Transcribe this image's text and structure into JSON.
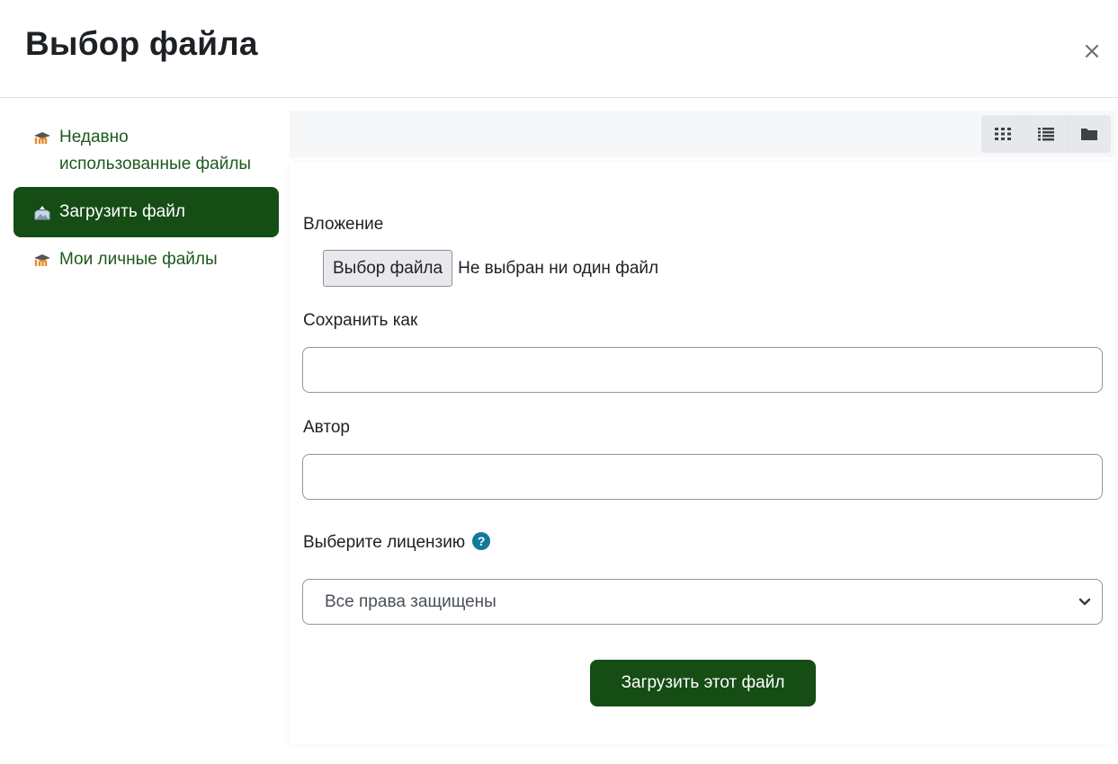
{
  "dialog": {
    "title": "Выбор файла",
    "close_symbol": "×"
  },
  "sidebar": {
    "items": [
      {
        "label": "Недавно использованные файлы",
        "icon": "moodle-logo-icon",
        "active": false
      },
      {
        "label": "Загрузить файл",
        "icon": "upload-icon",
        "active": true
      },
      {
        "label": "Мои личные файлы",
        "icon": "moodle-logo-icon",
        "active": false
      }
    ]
  },
  "toolbar": {
    "view_buttons": [
      {
        "icon": "grid-view-icon"
      },
      {
        "icon": "list-view-icon"
      },
      {
        "icon": "folder-view-icon"
      }
    ]
  },
  "form": {
    "attachment_label": "Вложение",
    "file_button_label": "Выбор файла",
    "file_status": "Не выбран ни один файл",
    "save_as_label": "Сохранить как",
    "save_as_value": "",
    "author_label": "Автор",
    "author_value": "",
    "license_label": "Выберите лицензию",
    "license_help_icon": "question-circle-icon",
    "license_selected": "Все права защищены",
    "submit_label": "Загрузить этот файл"
  },
  "colors": {
    "accent": "#154d15",
    "link": "#1d5a1d",
    "moodle_orange": "#e98a2f",
    "help_icon": "#137a9a"
  }
}
